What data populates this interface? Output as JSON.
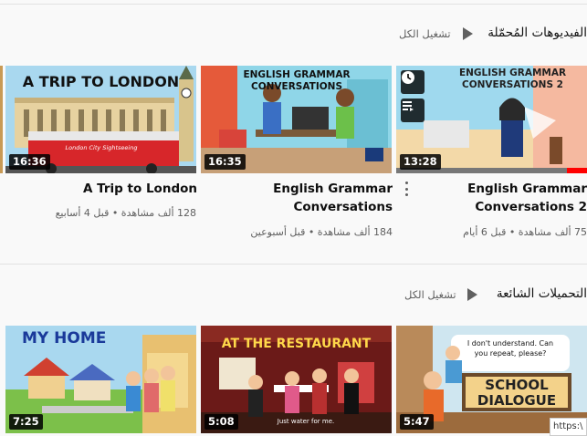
{
  "shelves": [
    {
      "title": "الفيديوهات المُحمّلة",
      "play_all": "تشغيل الكل",
      "videos": [
        {
          "thumb_text_line1": "ENGLISH GRAMMAR",
          "thumb_text_line2": "CONVERSATIONS 2",
          "duration": "13:28",
          "title_line1": "English Grammar",
          "title_line2": "Conversations 2",
          "meta": "75 ألف مشاهدة • قبل 6 أيام"
        },
        {
          "thumb_text_line1": "ENGLISH GRAMMAR",
          "thumb_text_line2": "CONVERSATIONS",
          "duration": "16:35",
          "title_line1": "English Grammar",
          "title_line2": "Conversations",
          "meta": "184 ألف مشاهدة • قبل أسبوعين"
        },
        {
          "thumb_text_line1": "A TRIP TO LONDON",
          "thumb_bus_text": "London City Sightseeing",
          "duration": "16:36",
          "title_line1": "A Trip to London",
          "meta": "128 ألف مشاهدة • قبل 4 أسابيع"
        }
      ]
    },
    {
      "title": "التحميلات الشائعة",
      "play_all": "تشغيل الكل",
      "videos": [
        {
          "thumb_text_line1": "I don't understand. Can",
          "thumb_text_line2": "you repeat, please?",
          "thumb_sign_line1": "SCHOOL",
          "thumb_sign_line2": "DIALOGUE",
          "duration": "5:47"
        },
        {
          "thumb_text_line1": "AT THE RESTAURANT",
          "thumb_caption": "Just water for me.",
          "duration": "5:08"
        },
        {
          "thumb_text_line1": "MY HOME",
          "duration": "7:25"
        }
      ]
    }
  ],
  "hover_icons": [
    "watch-later-icon",
    "add-to-queue-icon"
  ],
  "status_url": "https:\\",
  "colors": {
    "background": "#f9f9f9",
    "text": "#0f0f0f",
    "meta": "#606060",
    "progress": "#ff0000"
  }
}
